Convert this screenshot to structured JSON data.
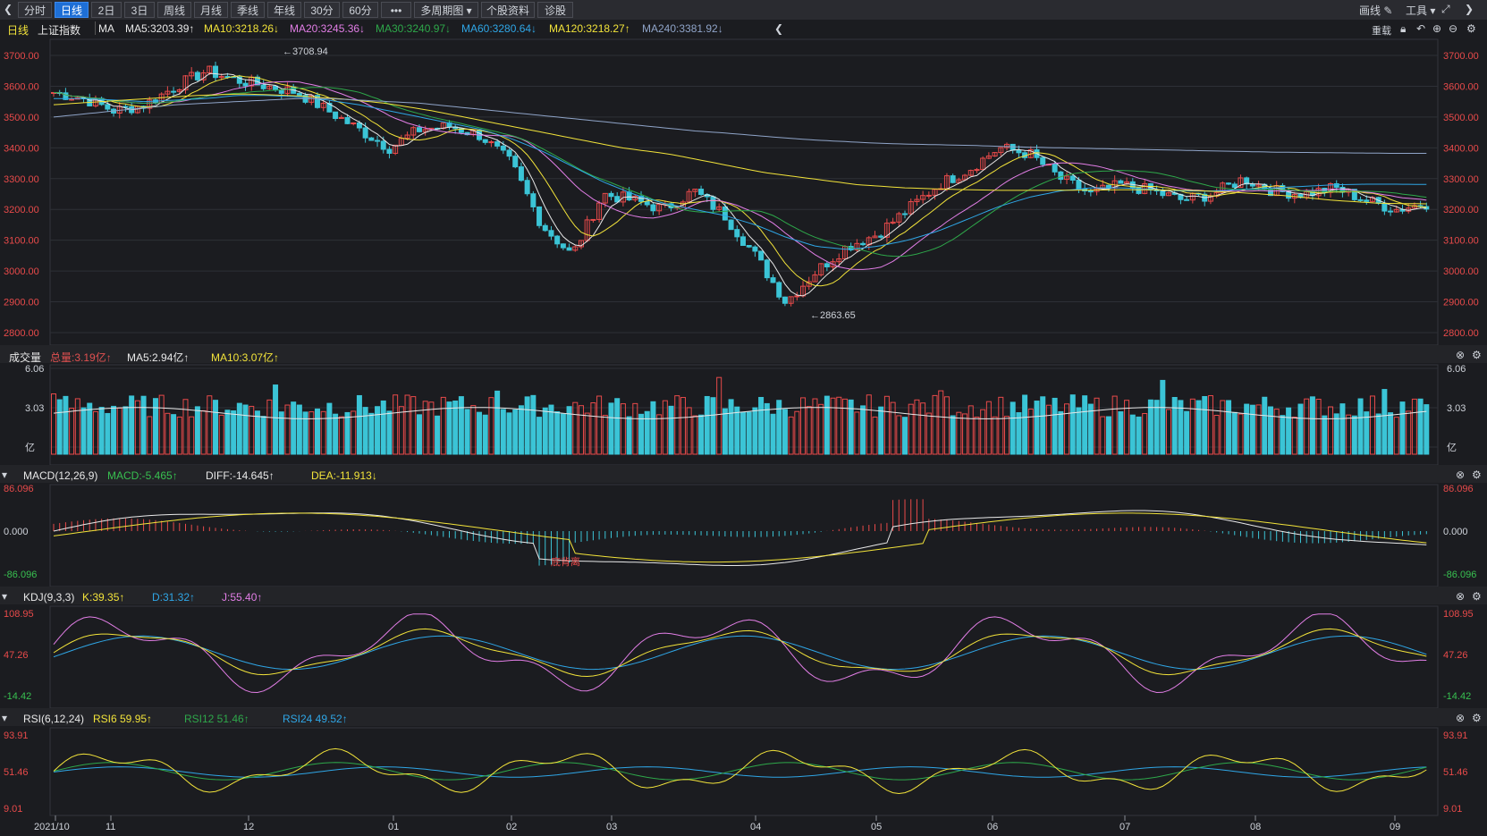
{
  "toolbar": {
    "back_icon": "back-chevron-icon",
    "tabs": [
      {
        "label": "分时",
        "active": false
      },
      {
        "label": "日线",
        "active": true
      },
      {
        "label": "2日",
        "active": false
      },
      {
        "label": "3日",
        "active": false
      },
      {
        "label": "周线",
        "active": false
      },
      {
        "label": "月线",
        "active": false
      },
      {
        "label": "季线",
        "active": false
      },
      {
        "label": "年线",
        "active": false
      },
      {
        "label": "30分",
        "active": false
      },
      {
        "label": "60分",
        "active": false
      },
      {
        "label": "•••",
        "active": false
      },
      {
        "label": "多周期图 ▾",
        "active": false
      },
      {
        "label": "个股资料",
        "active": false
      },
      {
        "label": "诊股",
        "active": false
      }
    ],
    "draw_label": "画线",
    "tools_label": "工具",
    "reload_label": "重载"
  },
  "info": {
    "period": "日线",
    "name": "上证指数",
    "ma_label": "MA",
    "ma": [
      {
        "text": "MA5:3203.39↑",
        "color": "#e8e8e8"
      },
      {
        "text": "MA10:3218.26↓",
        "color": "#f2e33a"
      },
      {
        "text": "MA20:3245.36↓",
        "color": "#e27ee6"
      },
      {
        "text": "MA30:3240.97↓",
        "color": "#2ea84a"
      },
      {
        "text": "MA60:3280.64↓",
        "color": "#2fa6e6"
      },
      {
        "text": "MA120:3218.27↑",
        "color": "#f2e33a"
      },
      {
        "text": "MA240:3381.92↓",
        "color": "#8fa4c8"
      }
    ]
  },
  "price_axis": [
    "3700.00",
    "3600.00",
    "3500.00",
    "3400.00",
    "3300.00",
    "3200.00",
    "3100.00",
    "3000.00",
    "2900.00",
    "2800.00"
  ],
  "annotations": {
    "high": "←3708.94",
    "low": "←2863.65",
    "divergence": "底背离"
  },
  "volume": {
    "title": "成交量",
    "stats": [
      {
        "text": "总量:3.19亿↑",
        "color": "#e05050"
      },
      {
        "text": "MA5:2.94亿↑",
        "color": "#e8e8e8"
      },
      {
        "text": "MA10:3.07亿↑",
        "color": "#f2e33a"
      }
    ],
    "axis": [
      "6.06",
      "3.03",
      "亿"
    ]
  },
  "macd": {
    "title": "MACD(12,26,9)",
    "stats": [
      {
        "text": "MACD:-5.465↑",
        "color": "#38c050"
      },
      {
        "text": "DIFF:-14.645↑",
        "color": "#e8e8e8"
      },
      {
        "text": "DEA:-11.913↓",
        "color": "#f2e33a"
      }
    ],
    "axis": [
      "86.096",
      "0.000",
      "-86.096"
    ]
  },
  "kdj": {
    "title": "KDJ(9,3,3)",
    "stats": [
      {
        "text": "K:39.35↑",
        "color": "#f2e33a"
      },
      {
        "text": "D:31.32↑",
        "color": "#2fa6e6"
      },
      {
        "text": "J:55.40↑",
        "color": "#e27ee6"
      }
    ],
    "axis": [
      "108.95",
      "47.26",
      "-14.42"
    ]
  },
  "rsi": {
    "title": "RSI(6,12,24)",
    "stats": [
      {
        "text": "RSI6 59.95↑",
        "color": "#f2e33a"
      },
      {
        "text": "RSI12 51.46↑",
        "color": "#2ea84a"
      },
      {
        "text": "RSI24 49.52↑",
        "color": "#2fa6e6"
      }
    ],
    "axis": [
      "93.91",
      "51.46",
      "9.01"
    ]
  },
  "time_axis": [
    "2021/10",
    "11",
    "12",
    "01",
    "02",
    "03",
    "04",
    "05",
    "06",
    "07",
    "08",
    "09"
  ],
  "colors": {
    "up": "#e84a4a",
    "down": "#3bc4d6",
    "bg": "#1b1c20",
    "grid": "#2e3036"
  },
  "chart_data": {
    "type": "candlestick",
    "title": "上证指数 日线",
    "ylim": [
      2800,
      3720
    ],
    "x": [
      "2021/10",
      "11",
      "12",
      "01",
      "02",
      "03",
      "04",
      "05",
      "06",
      "07",
      "08",
      "09"
    ],
    "series": [
      {
        "name": "close",
        "values": [
          3580,
          3560,
          3520,
          3540,
          3600,
          3650,
          3620,
          3600,
          3580,
          3520,
          3460,
          3400,
          3460,
          3470,
          3440,
          3350,
          3150,
          3050,
          3250,
          3230,
          3200,
          3260,
          3180,
          3050,
          2900,
          3000,
          3080,
          3120,
          3200,
          3280,
          3330,
          3400,
          3380,
          3300,
          3250,
          3280,
          3260,
          3230,
          3250,
          3300,
          3260,
          3250,
          3270,
          3230,
          3200,
          3220
        ]
      },
      {
        "name": "MA60",
        "values": [
          3560,
          3560,
          3555,
          3550,
          3555,
          3560,
          3570,
          3570,
          3565,
          3555,
          3540,
          3520,
          3500,
          3480,
          3460,
          3430,
          3390,
          3340,
          3290,
          3250,
          3220,
          3200,
          3180,
          3150,
          3110,
          3080,
          3070,
          3080,
          3100,
          3130,
          3170,
          3210,
          3240,
          3260,
          3270,
          3270,
          3265,
          3260,
          3260,
          3265,
          3270,
          3275,
          3280,
          3282,
          3282,
          3281
        ]
      },
      {
        "name": "MA240",
        "values": [
          3500,
          3510,
          3520,
          3530,
          3540,
          3545,
          3550,
          3555,
          3560,
          3560,
          3555,
          3550,
          3545,
          3535,
          3525,
          3515,
          3505,
          3495,
          3485,
          3475,
          3465,
          3455,
          3448,
          3440,
          3432,
          3425,
          3420,
          3415,
          3412,
          3410,
          3408,
          3405,
          3402,
          3400,
          3398,
          3396,
          3394,
          3392,
          3390,
          3388,
          3386,
          3385,
          3384,
          3383,
          3382,
          3382
        ]
      }
    ]
  }
}
